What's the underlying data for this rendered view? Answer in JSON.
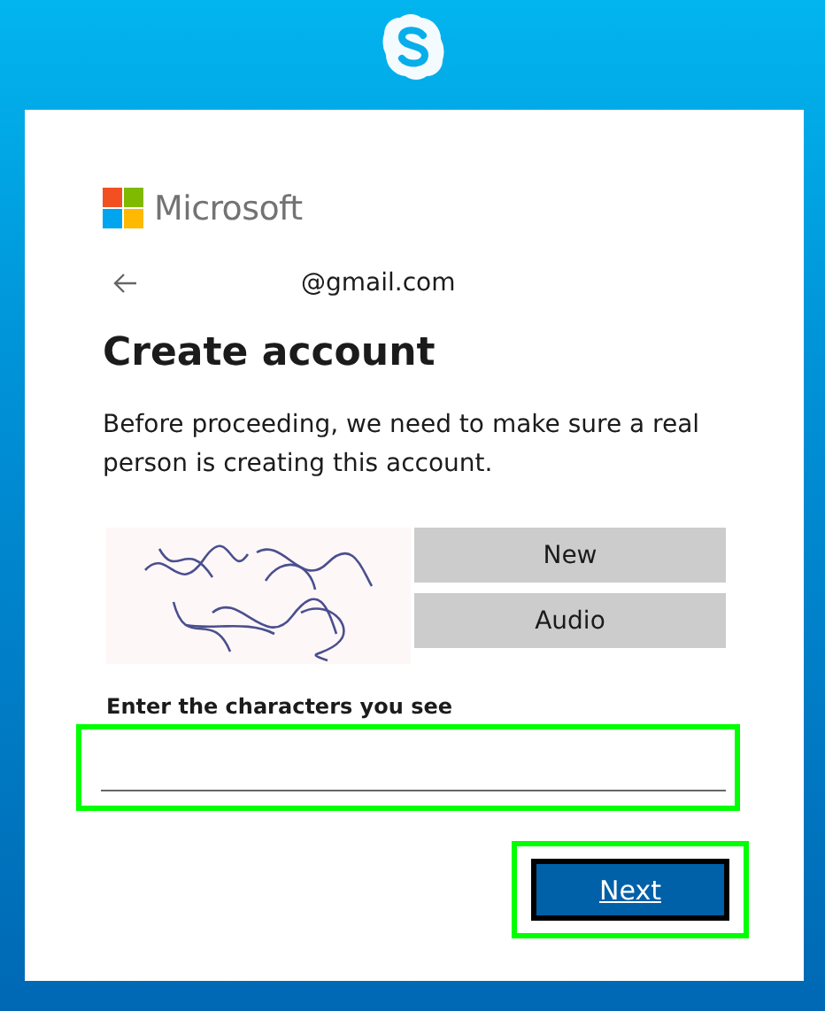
{
  "app_logo": {
    "kind": "skype"
  },
  "card": {
    "brand": "Microsoft",
    "account": "@gmail.com",
    "title": "Create account",
    "message": "Before proceeding, we need to make sure a real person is creating this account.",
    "captcha_buttons": [
      {
        "label": "New"
      },
      {
        "label": "Audio"
      }
    ],
    "field": {
      "label": "Enter the characters you see",
      "highlighted": true
    },
    "next_button": {
      "label": "Next",
      "highlighted": true
    }
  }
}
